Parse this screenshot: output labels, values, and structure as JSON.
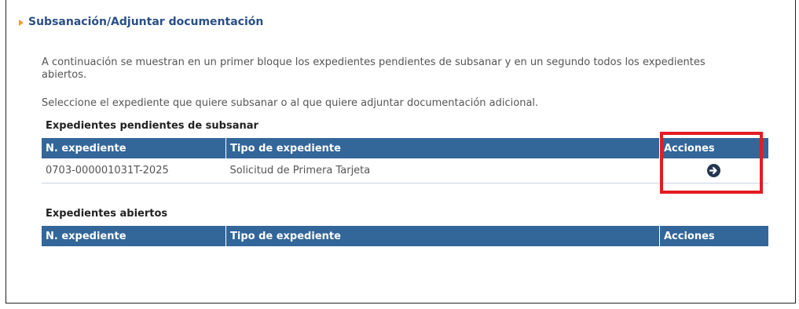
{
  "page": {
    "title": "Subsanación/Adjuntar documentación",
    "intro": "A continuación se muestran en un primer bloque los expedientes pendientes de subsanar y en un segundo todos los expedientes abiertos.",
    "instruction": "Seleccione el expediente que quiere subsanar o al que quiere adjuntar documentación adicional."
  },
  "pending": {
    "title": "Expedientes pendientes de subsanar",
    "columns": [
      "N. expediente",
      "Tipo de expediente",
      "Acciones"
    ],
    "rows": [
      {
        "number": "0703-000001031T-2025",
        "type": "Solicitud de Primera Tarjeta",
        "action_icon": "arrow-right-circle-icon"
      }
    ]
  },
  "open": {
    "title": "Expedientes abiertos",
    "columns": [
      "N. expediente",
      "Tipo de expediente",
      "Acciones"
    ],
    "rows": []
  },
  "colors": {
    "header_bg": "#336699",
    "title_color": "#2a4f86",
    "highlight": "#e31b23"
  }
}
